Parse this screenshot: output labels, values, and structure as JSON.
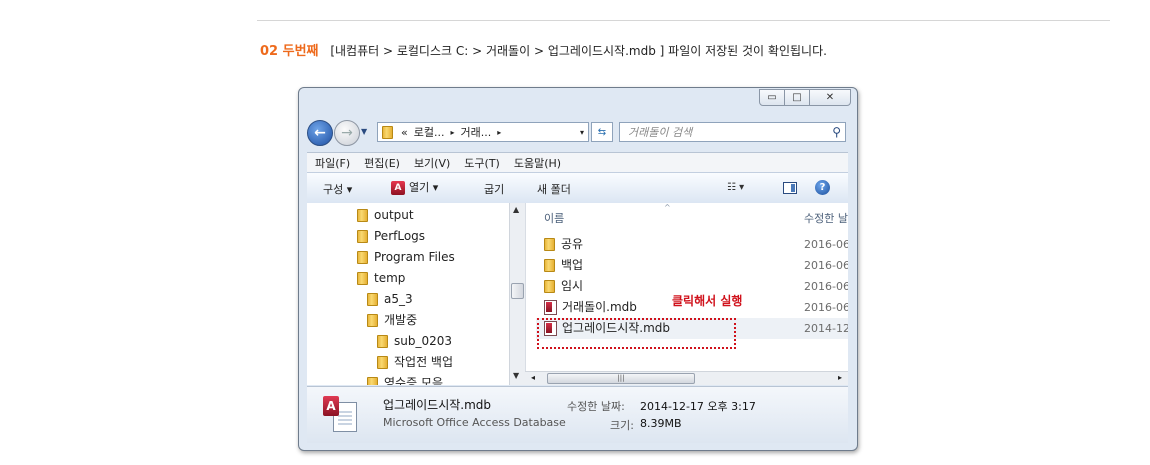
{
  "heading": {
    "step": "02 두번째",
    "path": "[내컴퓨터 > 로컬디스크 C: > 거래돌이 > 업그레이드시작.mdb ] 파일이 저장된 것이 확인됩니다."
  },
  "window": {
    "caption": {
      "minimize": "▭",
      "maximize": "□",
      "close": "✕"
    },
    "address": {
      "prefix": "«",
      "seg1": "로컬...",
      "seg2": "거래...",
      "arrow": "▸",
      "dropdown": "▾"
    },
    "search": {
      "placeholder": "거래돌이 검색"
    },
    "menu": [
      "파일(F)",
      "편집(E)",
      "보기(V)",
      "도구(T)",
      "도움말(H)"
    ],
    "commands": {
      "organize": "구성 ▾",
      "open": "열기 ▾",
      "burn": "굽기",
      "new_folder": "새 폴더"
    },
    "tree": [
      "output",
      "PerfLogs",
      "Program Files",
      "temp",
      "a5_3",
      "개발중",
      "sub_0203",
      "작업전 백업",
      "영수증 모음"
    ],
    "list": {
      "col_name": "이름",
      "col_date": "수정한 날",
      "rows": [
        {
          "name": "공유",
          "date": "2016-06",
          "kind": "folder"
        },
        {
          "name": "백업",
          "date": "2016-06",
          "kind": "folder"
        },
        {
          "name": "임시",
          "date": "2016-06",
          "kind": "folder"
        },
        {
          "name": "거래돌이.mdb",
          "date": "2016-06",
          "kind": "mdb"
        },
        {
          "name": "업그레이드시작.mdb",
          "date": "2014-12",
          "kind": "mdb"
        }
      ]
    },
    "details": {
      "name": "업그레이드시작.mdb",
      "type": "Microsoft Office Access Database",
      "modified_label": "수정한 날짜:",
      "modified_value": "2014-12-17 오후 3:17",
      "size_label": "크기:",
      "size_value": "8.39MB"
    }
  },
  "annotation": {
    "text": "클릭해서 실행",
    "color": "#d0111b"
  },
  "colors": {
    "accent": "#ee6a1c",
    "highlight": "#d0111b"
  }
}
